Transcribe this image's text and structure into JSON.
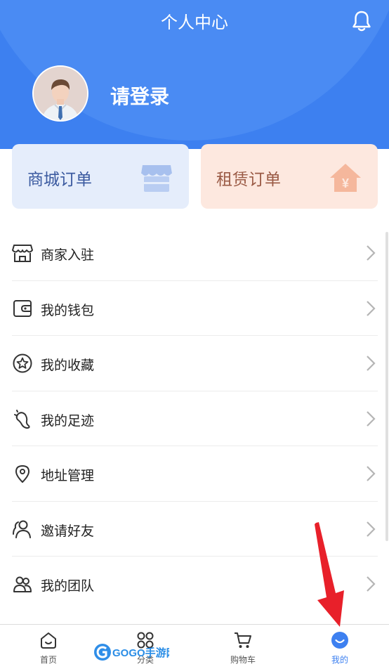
{
  "header": {
    "title": "个人中心",
    "login_text": "请登录"
  },
  "order_cards": [
    {
      "label": "商城订单",
      "icon": "store-icon"
    },
    {
      "label": "租赁订单",
      "icon": "house-yen-icon"
    }
  ],
  "menu": [
    {
      "label": "商家入驻",
      "icon": "shop-icon"
    },
    {
      "label": "我的钱包",
      "icon": "wallet-icon"
    },
    {
      "label": "我的收藏",
      "icon": "star-icon"
    },
    {
      "label": "我的足迹",
      "icon": "footprint-icon"
    },
    {
      "label": "地址管理",
      "icon": "location-pin-icon"
    },
    {
      "label": "邀请好友",
      "icon": "invite-friends-icon"
    },
    {
      "label": "我的团队",
      "icon": "team-icon"
    }
  ],
  "tabs": [
    {
      "label": "首页",
      "icon": "home-face-icon"
    },
    {
      "label": "分类",
      "icon": "grid-icon"
    },
    {
      "label": "购物车",
      "icon": "cart-icon"
    },
    {
      "label": "我的",
      "icon": "profile-smile-icon",
      "active": true
    }
  ],
  "watermark": {
    "text": "GOGO手游网"
  },
  "colors": {
    "primary": "#3d80f0",
    "mall_card_bg": "#e5edfb",
    "rent_card_bg": "#fde8df",
    "arrow": "#e8202a"
  }
}
